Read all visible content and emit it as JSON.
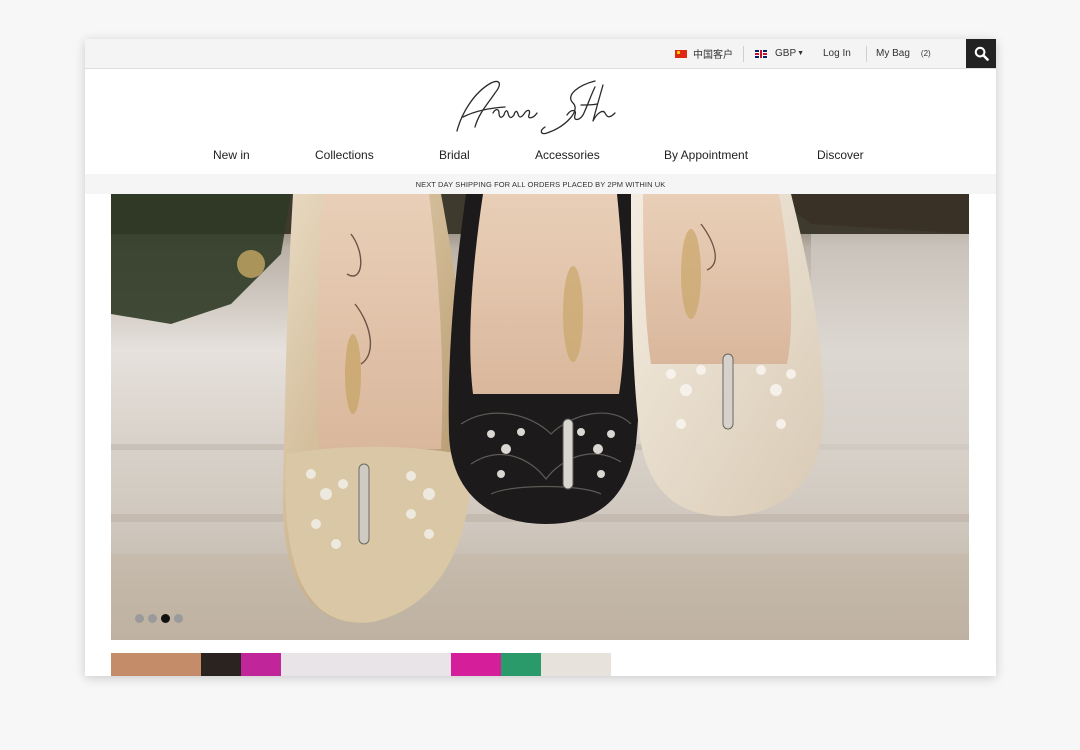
{
  "topbar": {
    "cn_label": "中国客户",
    "currency": "GBP",
    "login_label": "Log In",
    "bag_label": "My Bag",
    "bag_count": "(2)"
  },
  "brand": {
    "name": "Aruna Seth"
  },
  "nav": {
    "items": [
      {
        "label": "New in"
      },
      {
        "label": "Collections"
      },
      {
        "label": "Bridal"
      },
      {
        "label": "Accessories"
      },
      {
        "label": "By Appointment"
      },
      {
        "label": "Discover"
      }
    ]
  },
  "banner": {
    "shipping_text": "NEXT DAY SHIPPING FOR ALL ORDERS PLACED BY 2PM WITHIN UK"
  },
  "hero": {
    "slide_count": 4,
    "active_slide": 3
  },
  "colors": {
    "topbar_bg": "#f4f4f4",
    "search_bg": "#222222",
    "dot_active": "#111111",
    "dot_inactive": "#9a9a9a"
  },
  "icons": {
    "search": "search-icon",
    "cn_flag": "china-flag-icon",
    "uk_flag": "uk-flag-icon",
    "caret": "caret-down-icon"
  }
}
